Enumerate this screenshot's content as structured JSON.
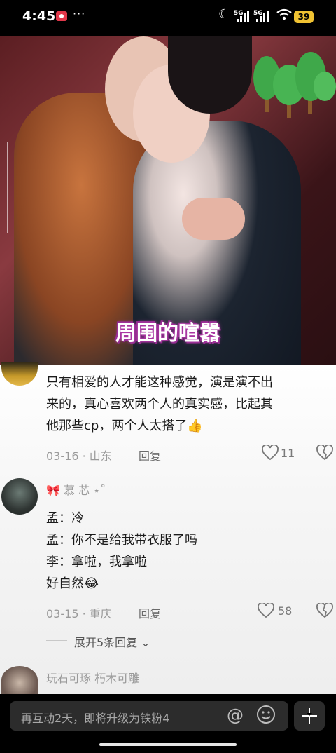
{
  "status_bar": {
    "time": "4:45",
    "dots": "···",
    "signal1": "5G",
    "signal2": "5G",
    "battery": "39"
  },
  "video": {
    "caption": "周围的喧嚣"
  },
  "comments": [
    {
      "lines": [
        "只有相爱的人才能这种感觉，演是演不出",
        "来的，真心喜欢两个人的真实感，比起其",
        "他那些cp，两个人太搭了👍"
      ],
      "date_location": "03-16 · 山东",
      "reply_label": "回复",
      "likes": "11"
    },
    {
      "username": "🎀 慕 芯 ⋆˚",
      "lines": [
        "孟：冷",
        "孟：你不是给我带衣服了吗",
        "李：拿啦，我拿啦",
        "好自然😂"
      ],
      "date_location": "03-15 · 重庆",
      "reply_label": "回复",
      "likes": "58",
      "expand_label": "展开5条回复"
    },
    {
      "username": "玩石可琢  朽木可雕"
    }
  ],
  "input": {
    "placeholder": "再互动2天，即将升级为铁粉4"
  },
  "colors": {
    "caption_glow": "#b03aa8",
    "battery": "#f0c232",
    "record": "#e0384a"
  },
  "icons": [
    "record-icon",
    "moon-icon",
    "wifi-icon",
    "heart-icon",
    "broken-heart-icon",
    "at-icon",
    "emoji-icon",
    "minimize-icon",
    "chevron-down-icon"
  ]
}
